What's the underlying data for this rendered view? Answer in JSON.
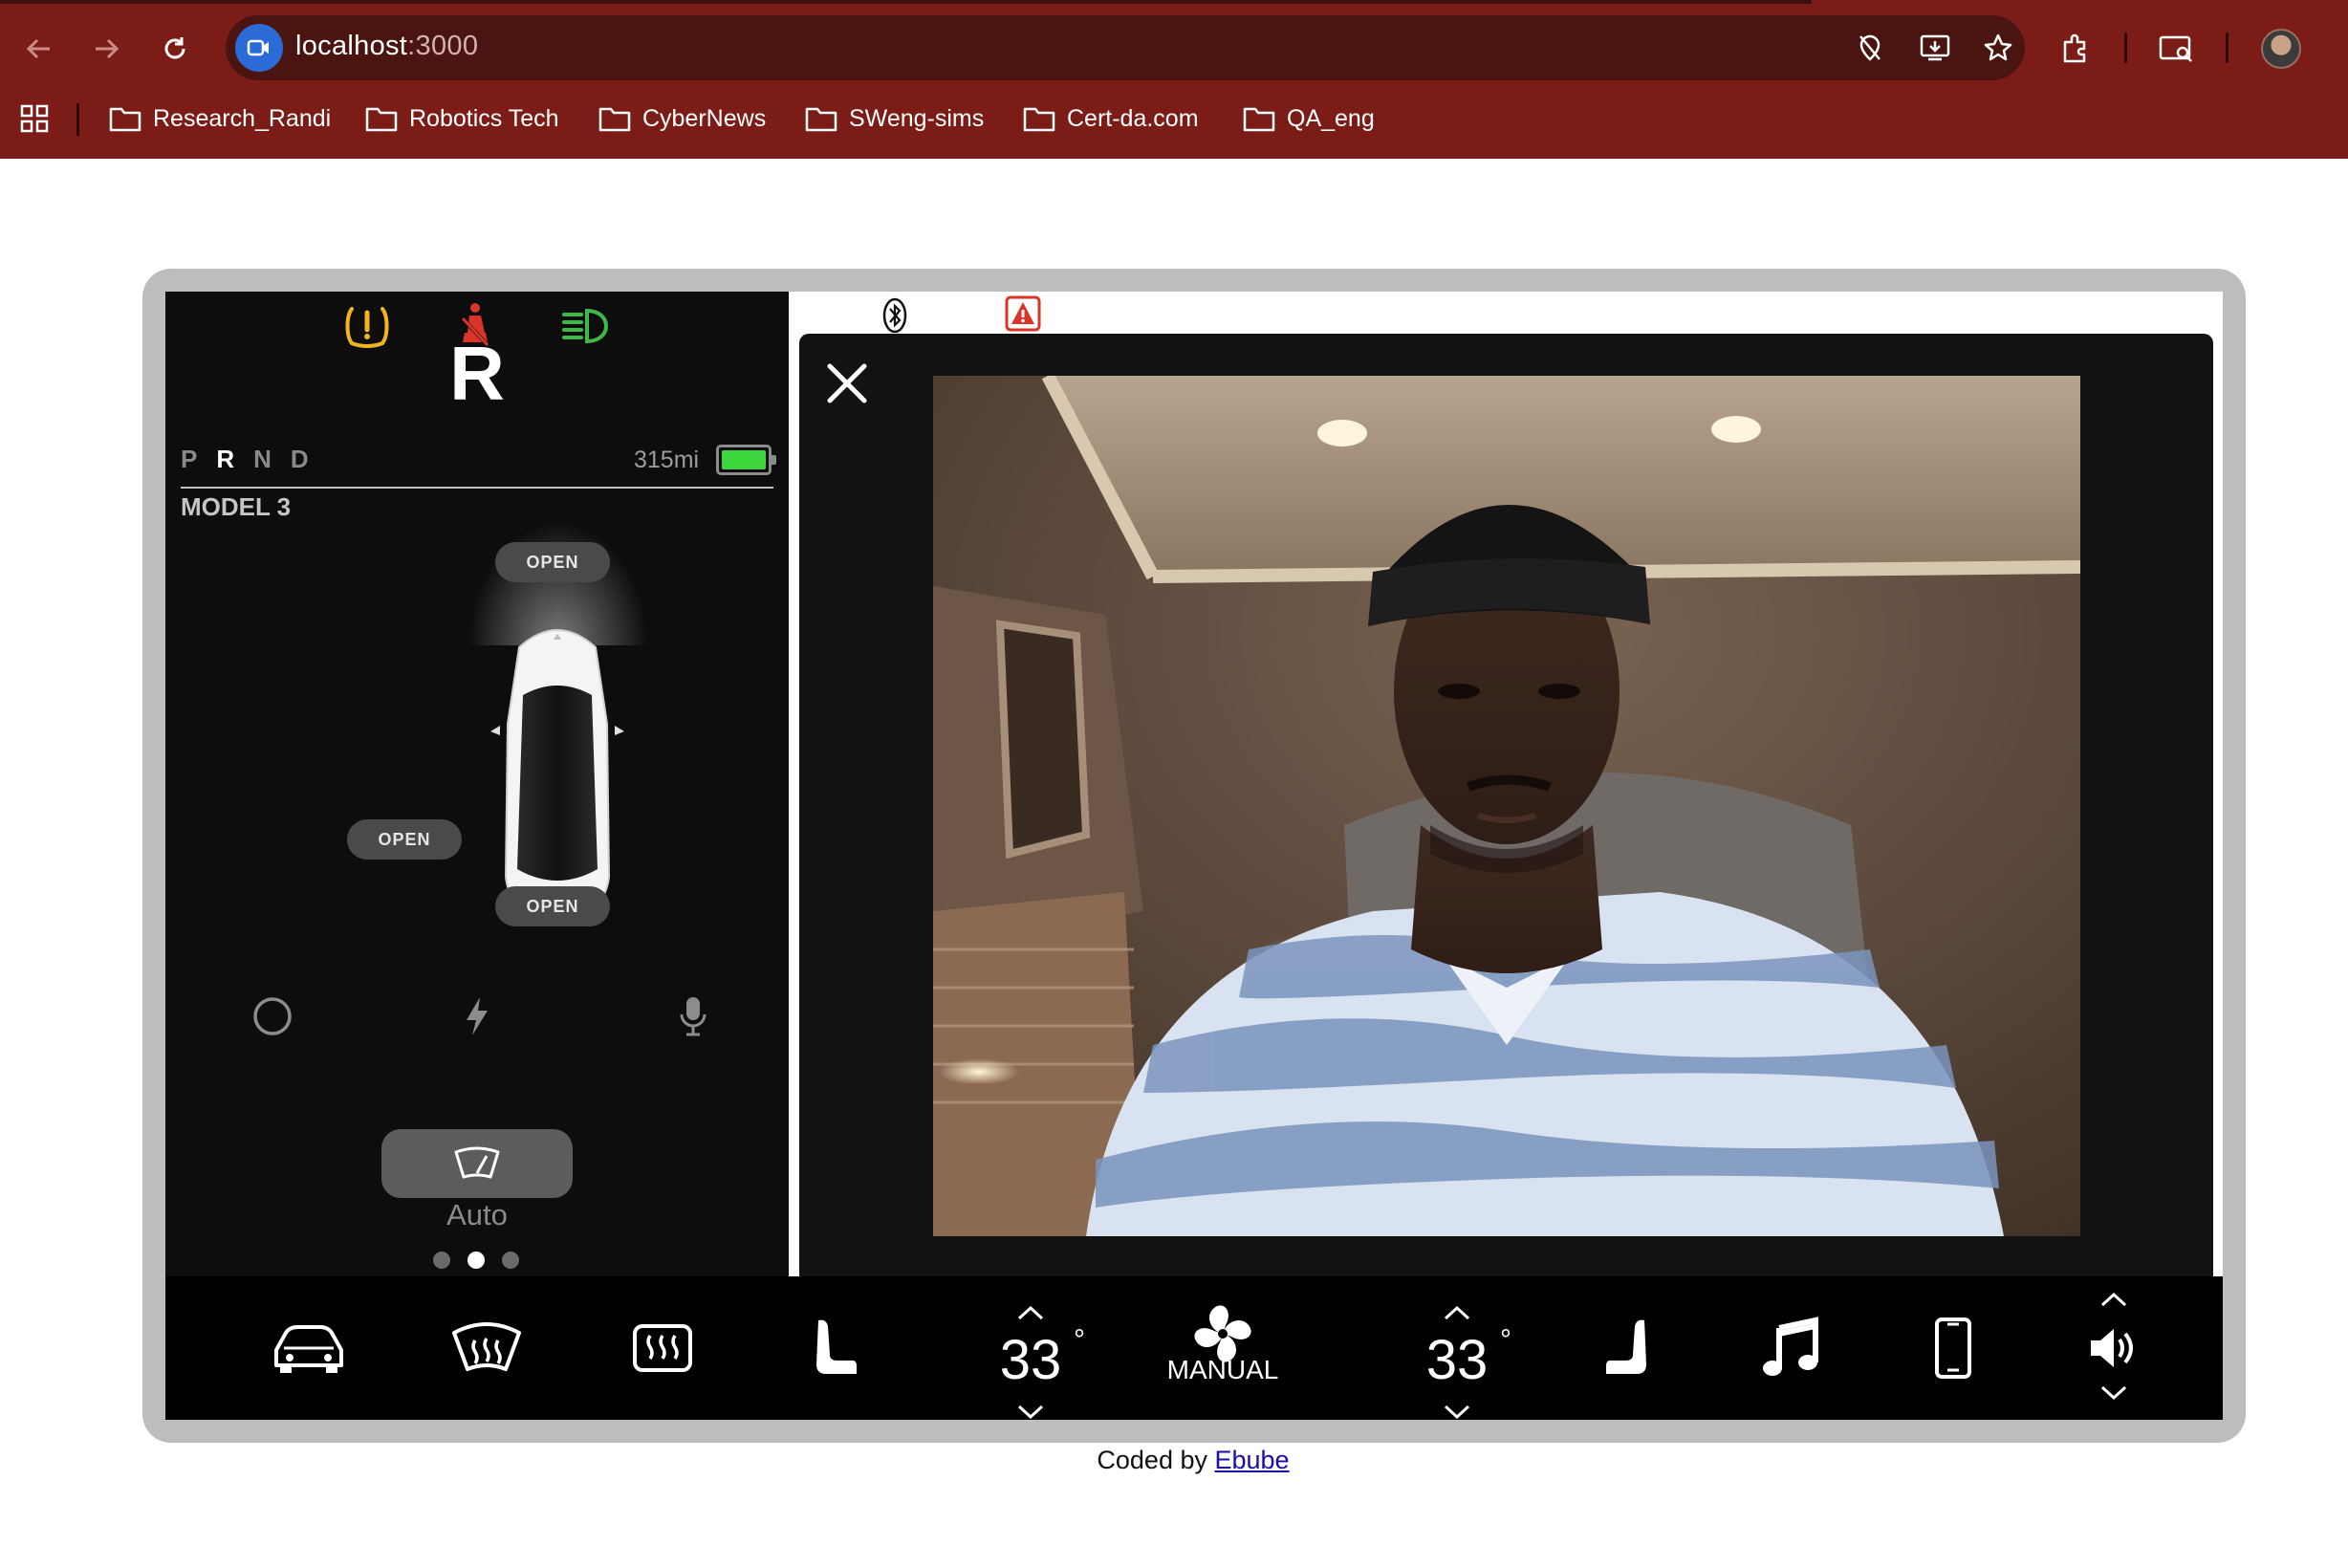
{
  "browser": {
    "url_host": "localhost",
    "url_port": ":3000",
    "bookmarks": [
      {
        "label": "Research_Randi"
      },
      {
        "label": "Robotics Tech"
      },
      {
        "label": "CyberNews"
      },
      {
        "label": "SWeng-sims"
      },
      {
        "label": "Cert-da.com"
      },
      {
        "label": "QA_eng"
      }
    ]
  },
  "dashboard": {
    "current_gear": "R",
    "gears": [
      "P",
      "R",
      "N",
      "D"
    ],
    "active_gear": "R",
    "range": "315mi",
    "battery_level": 1.0,
    "model": "MODEL 3",
    "frunk_label": "OPEN",
    "charge_port_label": "OPEN",
    "trunk_label": "OPEN",
    "wiper_mode": "Auto",
    "page_dots": {
      "count": 3,
      "active": 2
    },
    "tell_tales": [
      "tire-pressure-warning-icon",
      "seatbelt-warning-icon",
      "high-beam-icon"
    ]
  },
  "climate": {
    "driver_temp": "33",
    "passenger_temp": "33",
    "degree_symbol": "°",
    "fan_mode": "MANUAL"
  },
  "colors": {
    "chrome": "#7b1d16",
    "battery": "#3dd63d",
    "tire_warning": "#f2b320",
    "seatbelt_warning": "#d9352a",
    "high_beam": "#3fb84a"
  },
  "footer": {
    "prefix": "Coded by ",
    "link": "Ebube"
  }
}
